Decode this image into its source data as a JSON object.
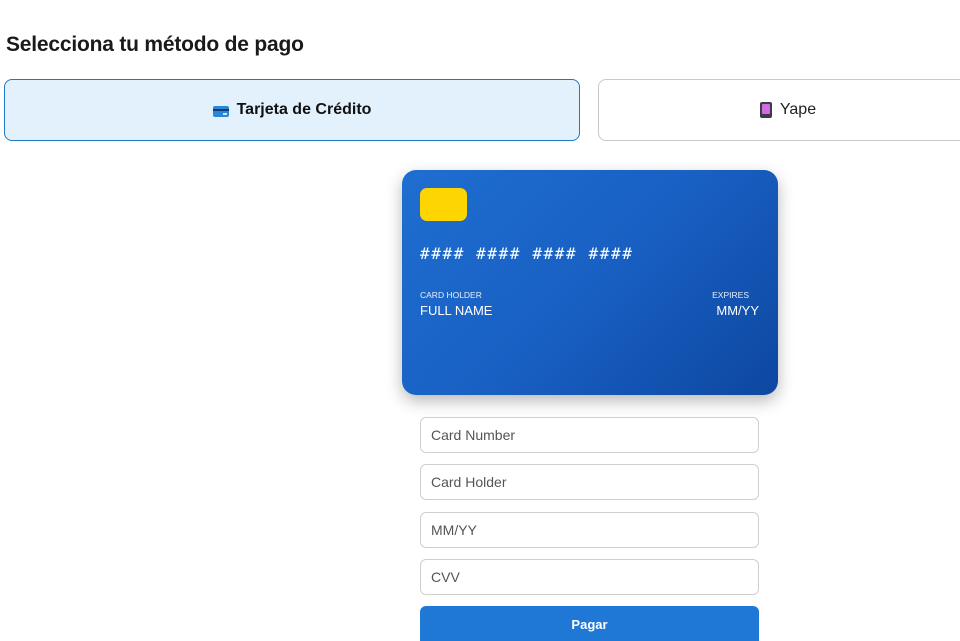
{
  "header": {
    "title": "Selecciona tu método de pago"
  },
  "payment_methods": [
    {
      "label": "Tarjeta de Crédito",
      "icon": "credit-card-icon",
      "selected": true
    },
    {
      "label": "Yape",
      "icon": "mobile-phone-icon",
      "selected": false
    }
  ],
  "card_preview": {
    "number": "#### #### #### ####",
    "holder_caption": "CARD HOLDER",
    "holder_value": "FULL NAME",
    "expires_caption": "EXPIRES",
    "expires_value": "MM/YY"
  },
  "form": {
    "card_number": {
      "placeholder": "Card Number",
      "value": ""
    },
    "card_holder": {
      "placeholder": "Card Holder",
      "value": ""
    },
    "expiry": {
      "placeholder": "MM/YY",
      "value": ""
    },
    "cvv": {
      "placeholder": "CVV",
      "value": ""
    },
    "submit_label": "Pagar"
  },
  "colors": {
    "accent": "#1f78d6",
    "selected_tab_bg": "#e3f1fc",
    "card_gradient_start": "#1e6ed0",
    "card_gradient_end": "#0d47a1",
    "chip": "#fdd500"
  }
}
